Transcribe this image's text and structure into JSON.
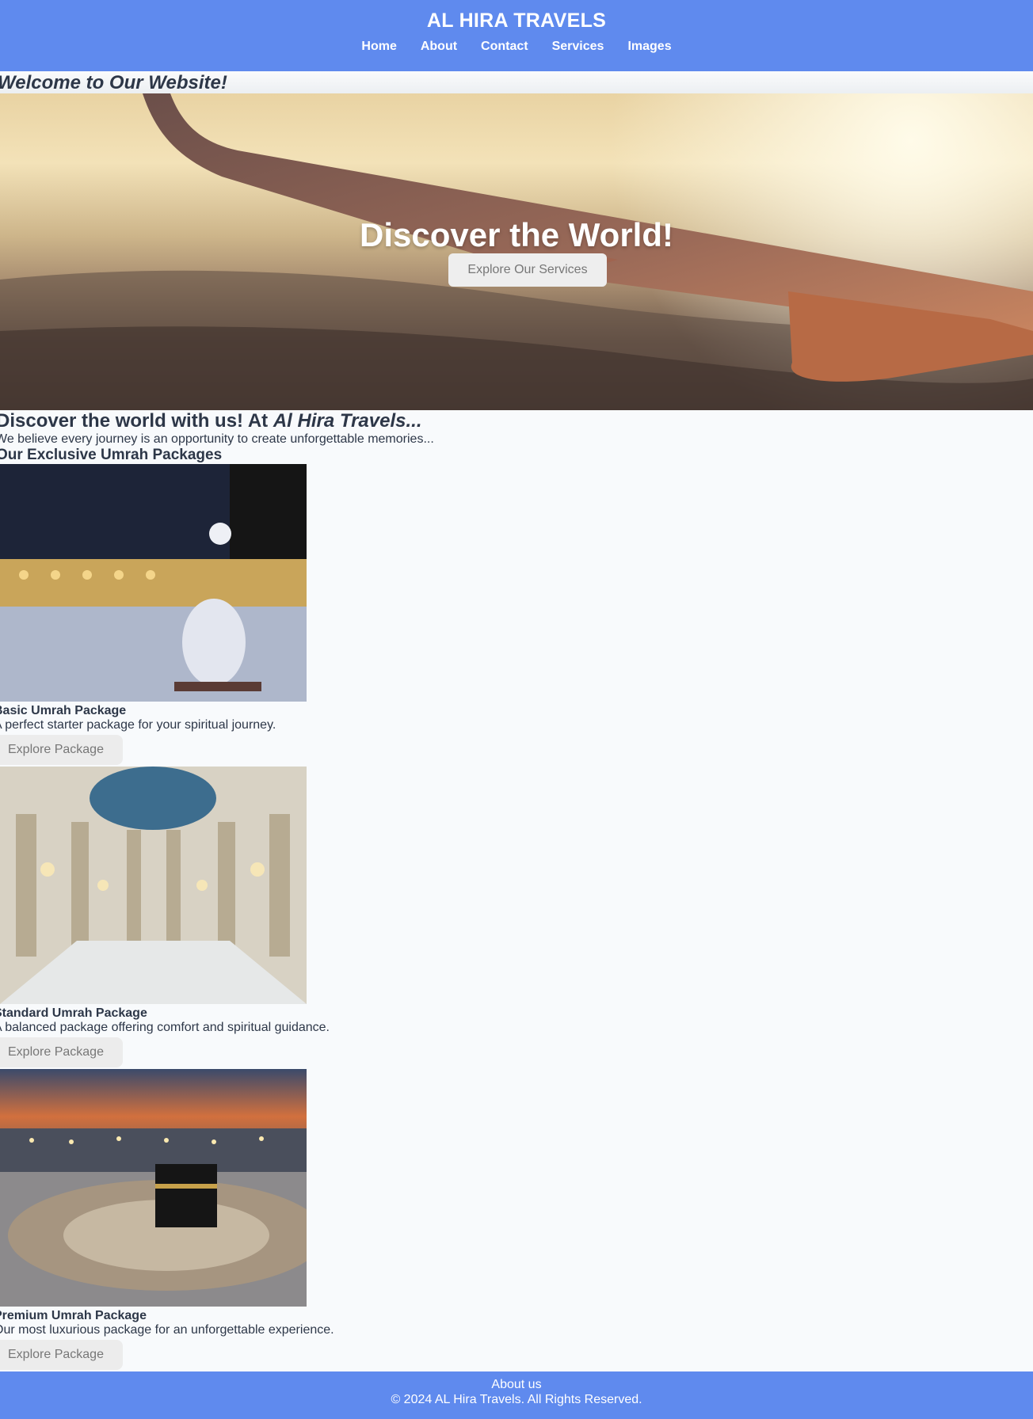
{
  "header": {
    "brand": "AL HIRA TRAVELS",
    "nav": [
      "Home",
      "About",
      "Contact",
      "Services",
      "Images"
    ]
  },
  "welcome": "Welcome to Our Website!",
  "hero": {
    "title": "Discover the World!",
    "button": "Explore Our Services"
  },
  "intro": {
    "title_prefix": "Discover the world with us! At ",
    "title_brand": "Al Hira Travels...",
    "text": "We believe every journey is an opportunity to create unforgettable memories..."
  },
  "packages": {
    "title": "Our Exclusive Umrah Packages",
    "items": [
      {
        "name": "Basic Umrah Package",
        "desc": "A perfect starter package for your spiritual journey.",
        "button": "Explore Package"
      },
      {
        "name": "Standard Umrah Package",
        "desc": "A balanced package offering comfort and spiritual guidance.",
        "button": "Explore Package"
      },
      {
        "name": "Premium Umrah Package",
        "desc": "Our most luxurious package for an unforgettable experience.",
        "button": "Explore Package"
      }
    ]
  },
  "footer": {
    "about": "About us",
    "copyright": "© 2024 AL Hira Travels. All Rights Reserved."
  },
  "colors": {
    "header_bg": "#5f8aee",
    "footer_bg": "#5f8aee",
    "button_bg": "#eeeeee",
    "text": "#2d3748"
  }
}
